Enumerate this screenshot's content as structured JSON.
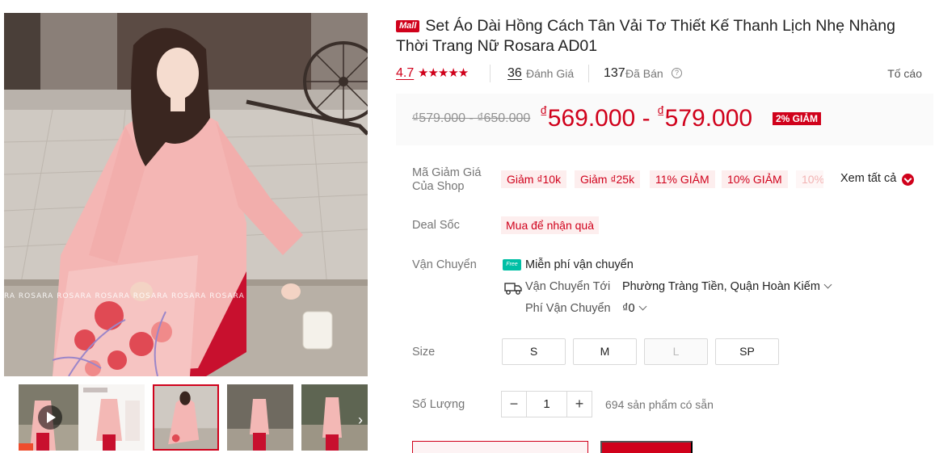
{
  "gallery": {
    "watermark": "RA ROSARA ROSARA ROSARA ROSARA ROSARA ROSARA",
    "thumbnails": [
      {
        "type": "video"
      },
      {
        "type": "image"
      },
      {
        "type": "image",
        "active": true
      },
      {
        "type": "image"
      },
      {
        "type": "image"
      }
    ],
    "next_icon": "chevron-right-icon"
  },
  "product": {
    "badge": "Mall",
    "title": "Set Áo Dài Hồng Cách Tân Vải Tơ Thiết Kế Thanh Lịch Nhẹ Nhàng Thời Trang Nữ Rosara AD01"
  },
  "rating": {
    "score": "4.7",
    "stars_text": "★★★★★",
    "stars_value": 4.7,
    "reviews_count": "36",
    "reviews_label": "Đánh Giá",
    "sold_count": "137",
    "sold_label": "Đã Bán",
    "help": "?",
    "report_label": "Tố cáo"
  },
  "price": {
    "original_range": "₫579.000 - ₫650.000",
    "currency": "₫",
    "current_min": "569.000",
    "separator": "-",
    "current_max": "579.000",
    "discount_badge": "2% GIẢM"
  },
  "vouchers": {
    "label": "Mã Giảm Giá Của Shop",
    "items": [
      "Giảm ₫10k",
      "Giảm ₫25k",
      "11% GIẢM",
      "10% GIẢM",
      "10% G"
    ],
    "see_all": "Xem tất cả"
  },
  "deal": {
    "label": "Deal Sốc",
    "tag": "Mua để nhận quà"
  },
  "shipping": {
    "label": "Vận Chuyển",
    "free_badge": "Free",
    "free_text": "Miễn phí vận chuyển",
    "ship_to_label": "Vận Chuyển Tới",
    "ship_to_value": "Phường Tràng Tiền, Quận Hoàn Kiếm",
    "fee_label": "Phí Vận Chuyển",
    "fee_value": "₫0"
  },
  "size": {
    "label": "Size",
    "options": [
      {
        "label": "S",
        "available": true
      },
      {
        "label": "M",
        "available": true
      },
      {
        "label": "L",
        "available": false
      },
      {
        "label": "SP",
        "available": true
      }
    ]
  },
  "quantity": {
    "label": "Số Lượng",
    "minus": "−",
    "value": "1",
    "plus": "+",
    "stock_text": "694 sản phẩm có sẵn"
  },
  "colors": {
    "accent": "#d0011b",
    "price_bg": "#fafafa",
    "voucher_bg": "#fdeeee",
    "free_ship": "#00bfa5"
  }
}
